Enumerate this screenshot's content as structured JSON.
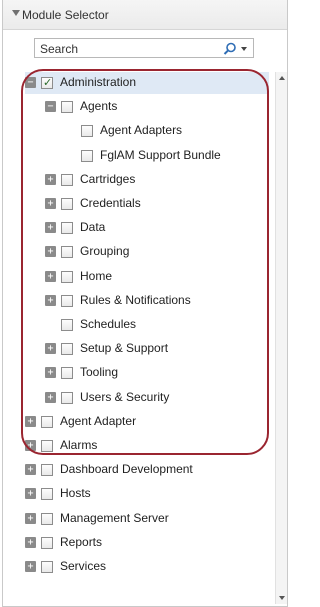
{
  "header": {
    "title": "Module Selector"
  },
  "search": {
    "value": "Search"
  },
  "tree": [
    {
      "key": "administration",
      "label": "Administration",
      "level": 0,
      "expander": "minus",
      "checked": true,
      "selected": true
    },
    {
      "key": "agents",
      "label": "Agents",
      "level": 1,
      "expander": "minus",
      "checked": false
    },
    {
      "key": "agent-adapters",
      "label": "Agent Adapters",
      "level": 2,
      "expander": "none",
      "checked": false
    },
    {
      "key": "fglam-support-bundle",
      "label": "FglAM Support Bundle",
      "level": 2,
      "expander": "none",
      "checked": false
    },
    {
      "key": "cartridges",
      "label": "Cartridges",
      "level": 1,
      "expander": "plus",
      "checked": false
    },
    {
      "key": "credentials",
      "label": "Credentials",
      "level": 1,
      "expander": "plus",
      "checked": false
    },
    {
      "key": "data",
      "label": "Data",
      "level": 1,
      "expander": "plus",
      "checked": false
    },
    {
      "key": "grouping",
      "label": "Grouping",
      "level": 1,
      "expander": "plus",
      "checked": false
    },
    {
      "key": "home",
      "label": "Home",
      "level": 1,
      "expander": "plus",
      "checked": false
    },
    {
      "key": "rules-notifications",
      "label": "Rules & Notifications",
      "level": 1,
      "expander": "plus",
      "checked": false
    },
    {
      "key": "schedules",
      "label": "Schedules",
      "level": 1,
      "expander": "none",
      "checked": false
    },
    {
      "key": "setup-support",
      "label": "Setup & Support",
      "level": 1,
      "expander": "plus",
      "checked": false
    },
    {
      "key": "tooling",
      "label": "Tooling",
      "level": 1,
      "expander": "plus",
      "checked": false
    },
    {
      "key": "users-security",
      "label": "Users & Security",
      "level": 1,
      "expander": "plus",
      "checked": false
    },
    {
      "key": "agent-adapter",
      "label": "Agent Adapter",
      "level": 0,
      "expander": "plus",
      "checked": false
    },
    {
      "key": "alarms",
      "label": "Alarms",
      "level": 0,
      "expander": "plus",
      "checked": false
    },
    {
      "key": "dashboard-development",
      "label": "Dashboard Development",
      "level": 0,
      "expander": "plus",
      "checked": false
    },
    {
      "key": "hosts",
      "label": "Hosts",
      "level": 0,
      "expander": "plus",
      "checked": false
    },
    {
      "key": "management-server",
      "label": "Management Server",
      "level": 0,
      "expander": "plus",
      "checked": false
    },
    {
      "key": "reports",
      "label": "Reports",
      "level": 0,
      "expander": "plus",
      "checked": false
    },
    {
      "key": "services",
      "label": "Services",
      "level": 0,
      "expander": "plus",
      "checked": false
    }
  ],
  "colors": {
    "highlight_border": "#9a2530",
    "selected_row": "#dfe9f5"
  },
  "icons": {
    "header": "collapse-arrow-icon",
    "search": "search-icon",
    "expand": "plus-icon",
    "collapse": "minus-icon"
  }
}
